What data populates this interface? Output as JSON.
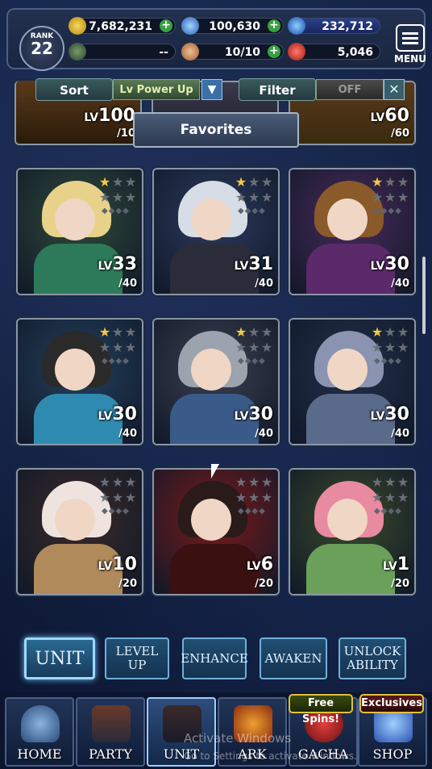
{
  "header": {
    "rank_label": "RANK",
    "rank_value": "22",
    "gold": "7,682,231",
    "crystals": "100,630",
    "orbs": "232,712",
    "slot2": "--",
    "stamina": "10/10",
    "redstone": "5,046",
    "menu_label": "MENU"
  },
  "sort_bar": {
    "sort_label": "Sort",
    "sort_value": "Lv Power Up",
    "filter_label": "Filter",
    "filter_value": "OFF",
    "favorites_label": "Favorites"
  },
  "top_partial_row": [
    {
      "lv": "100",
      "max": "/10"
    },
    {
      "lv": "60",
      "max": "/60"
    }
  ],
  "units": [
    {
      "lv": "33",
      "max": "/40",
      "stars": 1,
      "palette": [
        "#2f4a3a",
        "#e8d28a",
        "#2d7a5a"
      ]
    },
    {
      "lv": "31",
      "max": "/40",
      "stars": 1,
      "palette": [
        "#2c3a5e",
        "#d6dde6",
        "#2b2c3a"
      ]
    },
    {
      "lv": "30",
      "max": "/40",
      "stars": 1,
      "palette": [
        "#4a2a5a",
        "#8a5a2a",
        "#5a2a6a"
      ]
    },
    {
      "lv": "30",
      "max": "/40",
      "stars": 1,
      "palette": [
        "#24405e",
        "#2a2a2a",
        "#2f8ab0"
      ]
    },
    {
      "lv": "30",
      "max": "/40",
      "stars": 1,
      "palette": [
        "#3a4050",
        "#9aa3ae",
        "#3a5a8a"
      ]
    },
    {
      "lv": "30",
      "max": "/40",
      "stars": 1,
      "palette": [
        "#22304a",
        "#8a94b0",
        "#5a6a8a"
      ]
    },
    {
      "lv": "10",
      "max": "/20",
      "stars": 0,
      "palette": [
        "#3a2a2a",
        "#efe3df",
        "#b08a5a"
      ]
    },
    {
      "lv": "6",
      "max": "/20",
      "stars": 0,
      "palette": [
        "#7a1a1a",
        "#2a1a1a",
        "#3a1010"
      ]
    },
    {
      "lv": "1",
      "max": "/20",
      "stars": 0,
      "palette": [
        "#3a4a2a",
        "#e88aa0",
        "#6aa05a"
      ]
    }
  ],
  "lv_prefix": "LV",
  "actions": {
    "unit": "UNIT",
    "level_up_1": "LEVEL",
    "level_up_2": "UP",
    "enhance": "ENHANCE",
    "awaken": "AWAKEN",
    "unlock_1": "UNLOCK",
    "unlock_2": "ABILITY"
  },
  "nav": {
    "home": "HOME",
    "party": "PARTY",
    "unit": "UNIT",
    "ark": "ARK",
    "gacha": "GACHA",
    "shop": "SHOP",
    "free_spins": "Free Spins!",
    "exclusives": "Exclusives"
  },
  "watermark": {
    "line1": "Activate Windows",
    "line2": "Go to Settings to activate Windows."
  },
  "colors": {
    "plus_green": "#38a043",
    "accent_blue": "#6fb0d8",
    "star_gold": "#f3c944"
  }
}
